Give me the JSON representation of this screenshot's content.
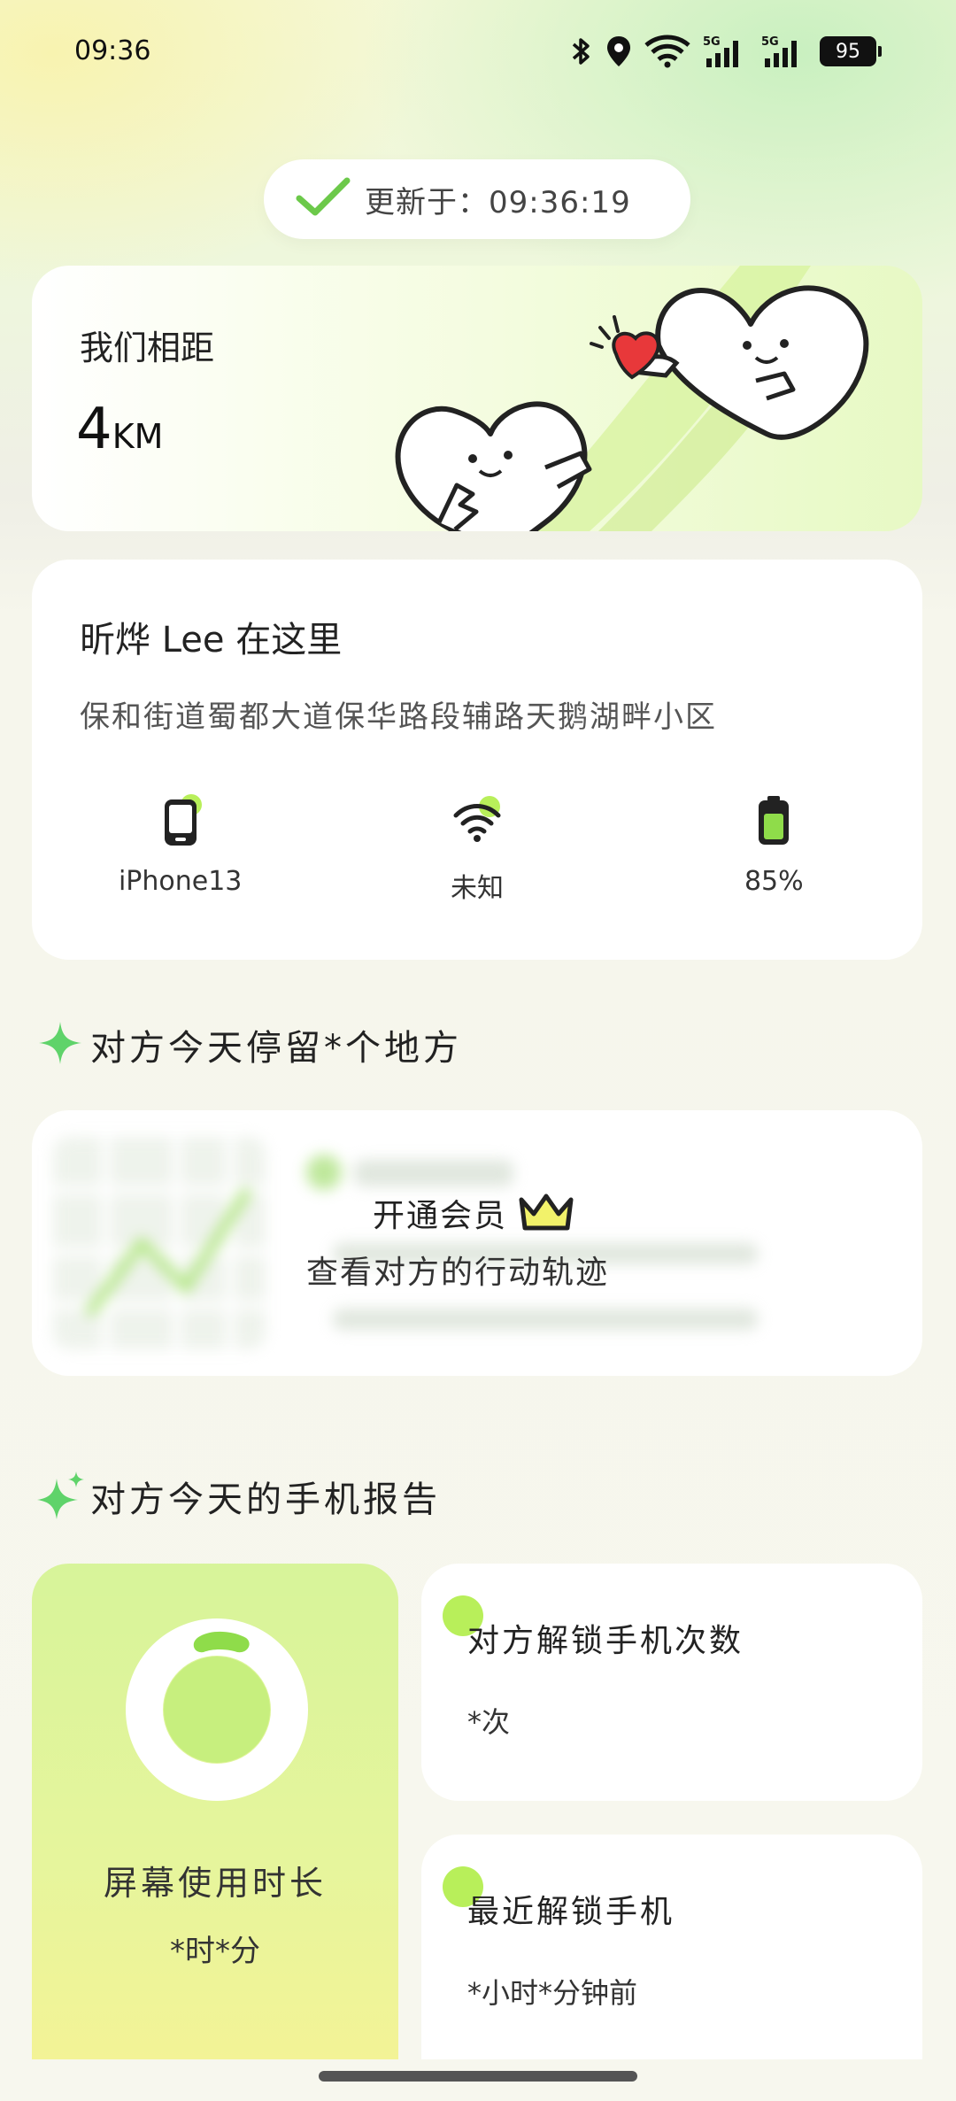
{
  "status_bar": {
    "time": "09:36",
    "battery": "95"
  },
  "update": {
    "label": "更新于：09:36:19"
  },
  "distance": {
    "title": "我们相距",
    "value": "4",
    "unit": "KM"
  },
  "location": {
    "name": "昕烨 Lee 在这里",
    "address": "保和街道蜀都大道保华路段辅路天鹅湖畔小区",
    "stats": [
      {
        "label": "iPhone13",
        "icon": "phone-icon"
      },
      {
        "label": "未知",
        "icon": "wifi-icon"
      },
      {
        "label": "85%",
        "icon": "battery-icon"
      }
    ]
  },
  "stays": {
    "heading": "对方今天停留*个地方",
    "vip_label": "开通会员",
    "vip_desc": "查看对方的行动轨迹"
  },
  "report": {
    "heading": "对方今天的手机报告",
    "screen_time": {
      "label": "屏幕使用时长",
      "value": "*时*分"
    },
    "unlock_count": {
      "label": "对方解锁手机次数",
      "value": "*次"
    },
    "last_unlock": {
      "label": "最近解锁手机",
      "value": "*小时*分钟前"
    }
  },
  "colors": {
    "accent_green": "#8fdc4a",
    "light_green": "#b8ef5a",
    "crown_yellow": "#f2f26a"
  }
}
